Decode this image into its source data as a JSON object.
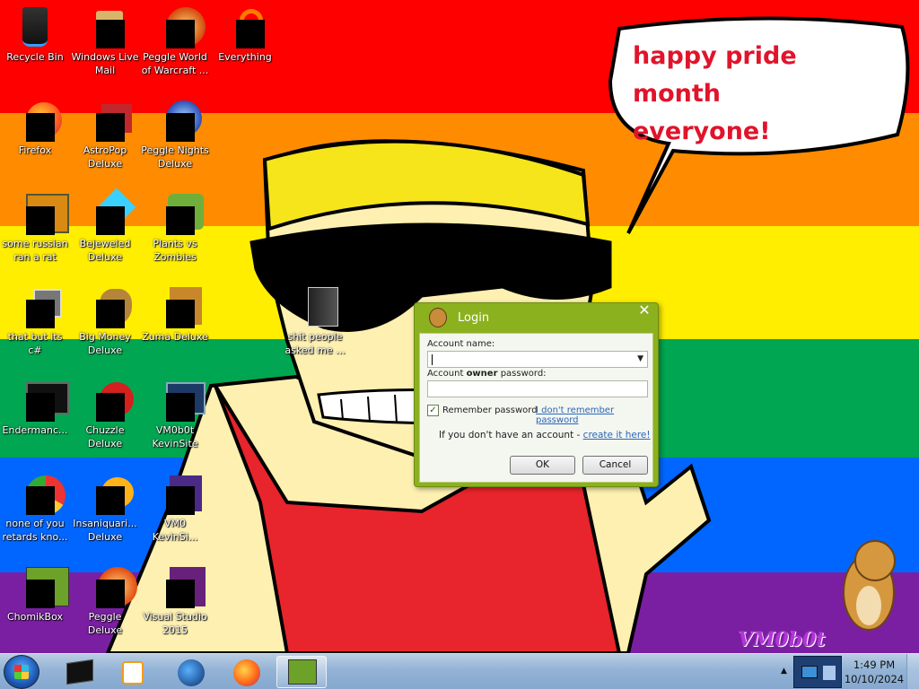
{
  "wallpaper": {
    "stripe_colors": [
      "#ff0000",
      "#ff8c00",
      "#ffee00",
      "#00a651",
      "#0066ff",
      "#7a1fa2"
    ],
    "speech_bubble_lines": [
      "happy pride month",
      "everyone!"
    ],
    "watermark": "VM0b0t"
  },
  "desktop_icons": [
    {
      "label": "Recycle Bin",
      "icon": "recycle-bin-icon"
    },
    {
      "label": "Windows Live\nMail",
      "icon": "mail-icon"
    },
    {
      "label": "Peggle World\nof Warcraft ...",
      "icon": "peggle-wow-icon"
    },
    {
      "label": "Everything",
      "icon": "search-app-icon"
    },
    {
      "label": "Firefox",
      "icon": "firefox-icon"
    },
    {
      "label": "AstroPop\nDeluxe",
      "icon": "astropop-icon"
    },
    {
      "label": "Peggle Nights\nDeluxe",
      "icon": "peggle-nights-icon"
    },
    {
      "label": "some russian\nran a rat",
      "icon": "file-icon"
    },
    {
      "label": "Bejeweled\nDeluxe",
      "icon": "bejeweled-icon"
    },
    {
      "label": "Plants vs\nZombies",
      "icon": "pvz-icon"
    },
    {
      "label": "that but its c#",
      "icon": "folder-stack-icon"
    },
    {
      "label": "Big Money\nDeluxe",
      "icon": "money-bag-icon"
    },
    {
      "label": "Zuma Deluxe",
      "icon": "zuma-icon"
    },
    {
      "label": "Endermanc...",
      "icon": "terminal-icon"
    },
    {
      "label": "Chuzzle\nDeluxe",
      "icon": "chuzzle-icon"
    },
    {
      "label": "VM0b0t\nKevinSite",
      "icon": "website-icon"
    },
    {
      "label": "none of you\nretards kno...",
      "icon": "chrome-icon"
    },
    {
      "label": "Insaniquari...\nDeluxe",
      "icon": "insaniquarium-icon"
    },
    {
      "label": "VM0\nKevinSi...",
      "icon": "website-icon-2"
    },
    {
      "label": "ChomikBox",
      "icon": "chomikbox-icon"
    },
    {
      "label": "Peggle Deluxe",
      "icon": "peggle-icon"
    },
    {
      "label": "Visual Studio\n2015",
      "icon": "visual-studio-icon"
    },
    {
      "label": "shit people\nasked me ...",
      "icon": "folder-icon"
    }
  ],
  "login_dialog": {
    "title": "Login",
    "account_name_label": "Account name:",
    "account_name_value": "",
    "password_label_prefix": "Account ",
    "password_label_bold": "owner",
    "password_label_suffix": " password:",
    "remember_label": "Remember password",
    "remember_checked": "✓",
    "forgot_link": "I don't remember password",
    "no_account_text": "If you don't have an account - ",
    "create_link": "create it here!",
    "ok_label": "OK",
    "cancel_label": "Cancel"
  },
  "taskbar": {
    "pinned": [
      "cmd-icon",
      "media-player-icon",
      "globe-icon",
      "firefox-icon",
      "chomikbox-icon"
    ],
    "clock_time": "1:49 PM",
    "clock_date": "10/10/2024"
  }
}
